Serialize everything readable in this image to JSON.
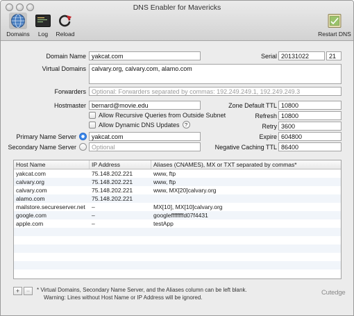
{
  "window": {
    "title": "DNS Enabler for Mavericks"
  },
  "toolbar": {
    "domains": "Domains",
    "log": "Log",
    "reload": "Reload",
    "restart_dns": "Restart DNS"
  },
  "form": {
    "domain_name_label": "Domain Name",
    "domain_name_value": "yakcat.com",
    "serial_label": "Serial",
    "serial_value": "20131022",
    "serial_suffix": "21",
    "virtual_domains_label": "Virtual Domains",
    "virtual_domains_value": "calvary.org, calvary.com, alamo.com",
    "forwarders_label": "Forwarders",
    "forwarders_placeholder": "Optional: Forwarders separated by commas: 192.249.249.1, 192.249.249.3",
    "hostmaster_label": "Hostmaster",
    "hostmaster_value": "bernard@movie.edu",
    "allow_recursive_label": "Allow Recursive Queries from Outside Subnet",
    "allow_dynamic_label": "Allow Dynamic DNS Updates",
    "help_symbol": "?",
    "primary_ns_label": "Primary Name Server",
    "primary_ns_value": "yakcat.com",
    "secondary_ns_label": "Secondary Name Server",
    "secondary_ns_placeholder": "Optional",
    "zone_ttl_label": "Zone Default TTL",
    "zone_ttl_value": "10800",
    "refresh_label": "Refresh",
    "refresh_value": "10800",
    "retry_label": "Retry",
    "retry_value": "3600",
    "expire_label": "Expire",
    "expire_value": "604800",
    "neg_ttl_label": "Negative Caching TTL",
    "neg_ttl_value": "86400"
  },
  "table": {
    "headers": [
      "Host Name",
      "IP Address",
      "Aliases (CNAMES), MX or TXT separated by commas*"
    ],
    "rows": [
      [
        "yakcat.com",
        "75.148.202.221",
        "www, ftp"
      ],
      [
        "calvary.org",
        "75.148.202.221",
        "www, ftp"
      ],
      [
        "calvary.com",
        "75.148.202.221",
        "www, MX[20]calvary.org"
      ],
      [
        "alamo.com",
        "75.148.202.221",
        ""
      ],
      [
        "mailstore.secureserver.net",
        "–",
        "MX[10], MX[10]calvary.org"
      ],
      [
        "google.com",
        "–",
        "googleffffffffd07f4431"
      ],
      [
        "apple.com",
        "–",
        "testApp"
      ]
    ]
  },
  "footer": {
    "add": "+",
    "remove": "−",
    "note_line1": "* Virtual Domains, Secondary Name Server, and the Aliases column can be left blank.",
    "note_line2": "Warning: Lines without Host Name or IP Address will be ignored.",
    "brand": "Cutedge"
  }
}
